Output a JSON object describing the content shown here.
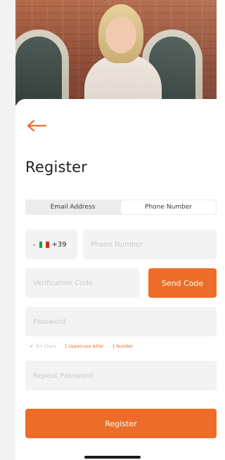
{
  "screen": {
    "title": "Register",
    "back_icon": "arrow-left-icon",
    "accent_color": "#ed6d28"
  },
  "tabs": [
    {
      "label": "Email Address",
      "active": false
    },
    {
      "label": "Phone Number",
      "active": true
    }
  ],
  "phone": {
    "country_code": "+39",
    "country_flag": "italy-flag-icon",
    "placeholder": "Phone Number"
  },
  "verification": {
    "placeholder": "Verification Code",
    "send_label": "Send Code"
  },
  "password": {
    "placeholder": "Password",
    "rules": [
      {
        "label": "6+ Chars",
        "met": true
      },
      {
        "label": "1 Uppercase letter",
        "met": false
      },
      {
        "label": "1 Number",
        "met": false
      }
    ]
  },
  "repeat_password": {
    "placeholder": "Repeat Password"
  },
  "register_label": "Register"
}
